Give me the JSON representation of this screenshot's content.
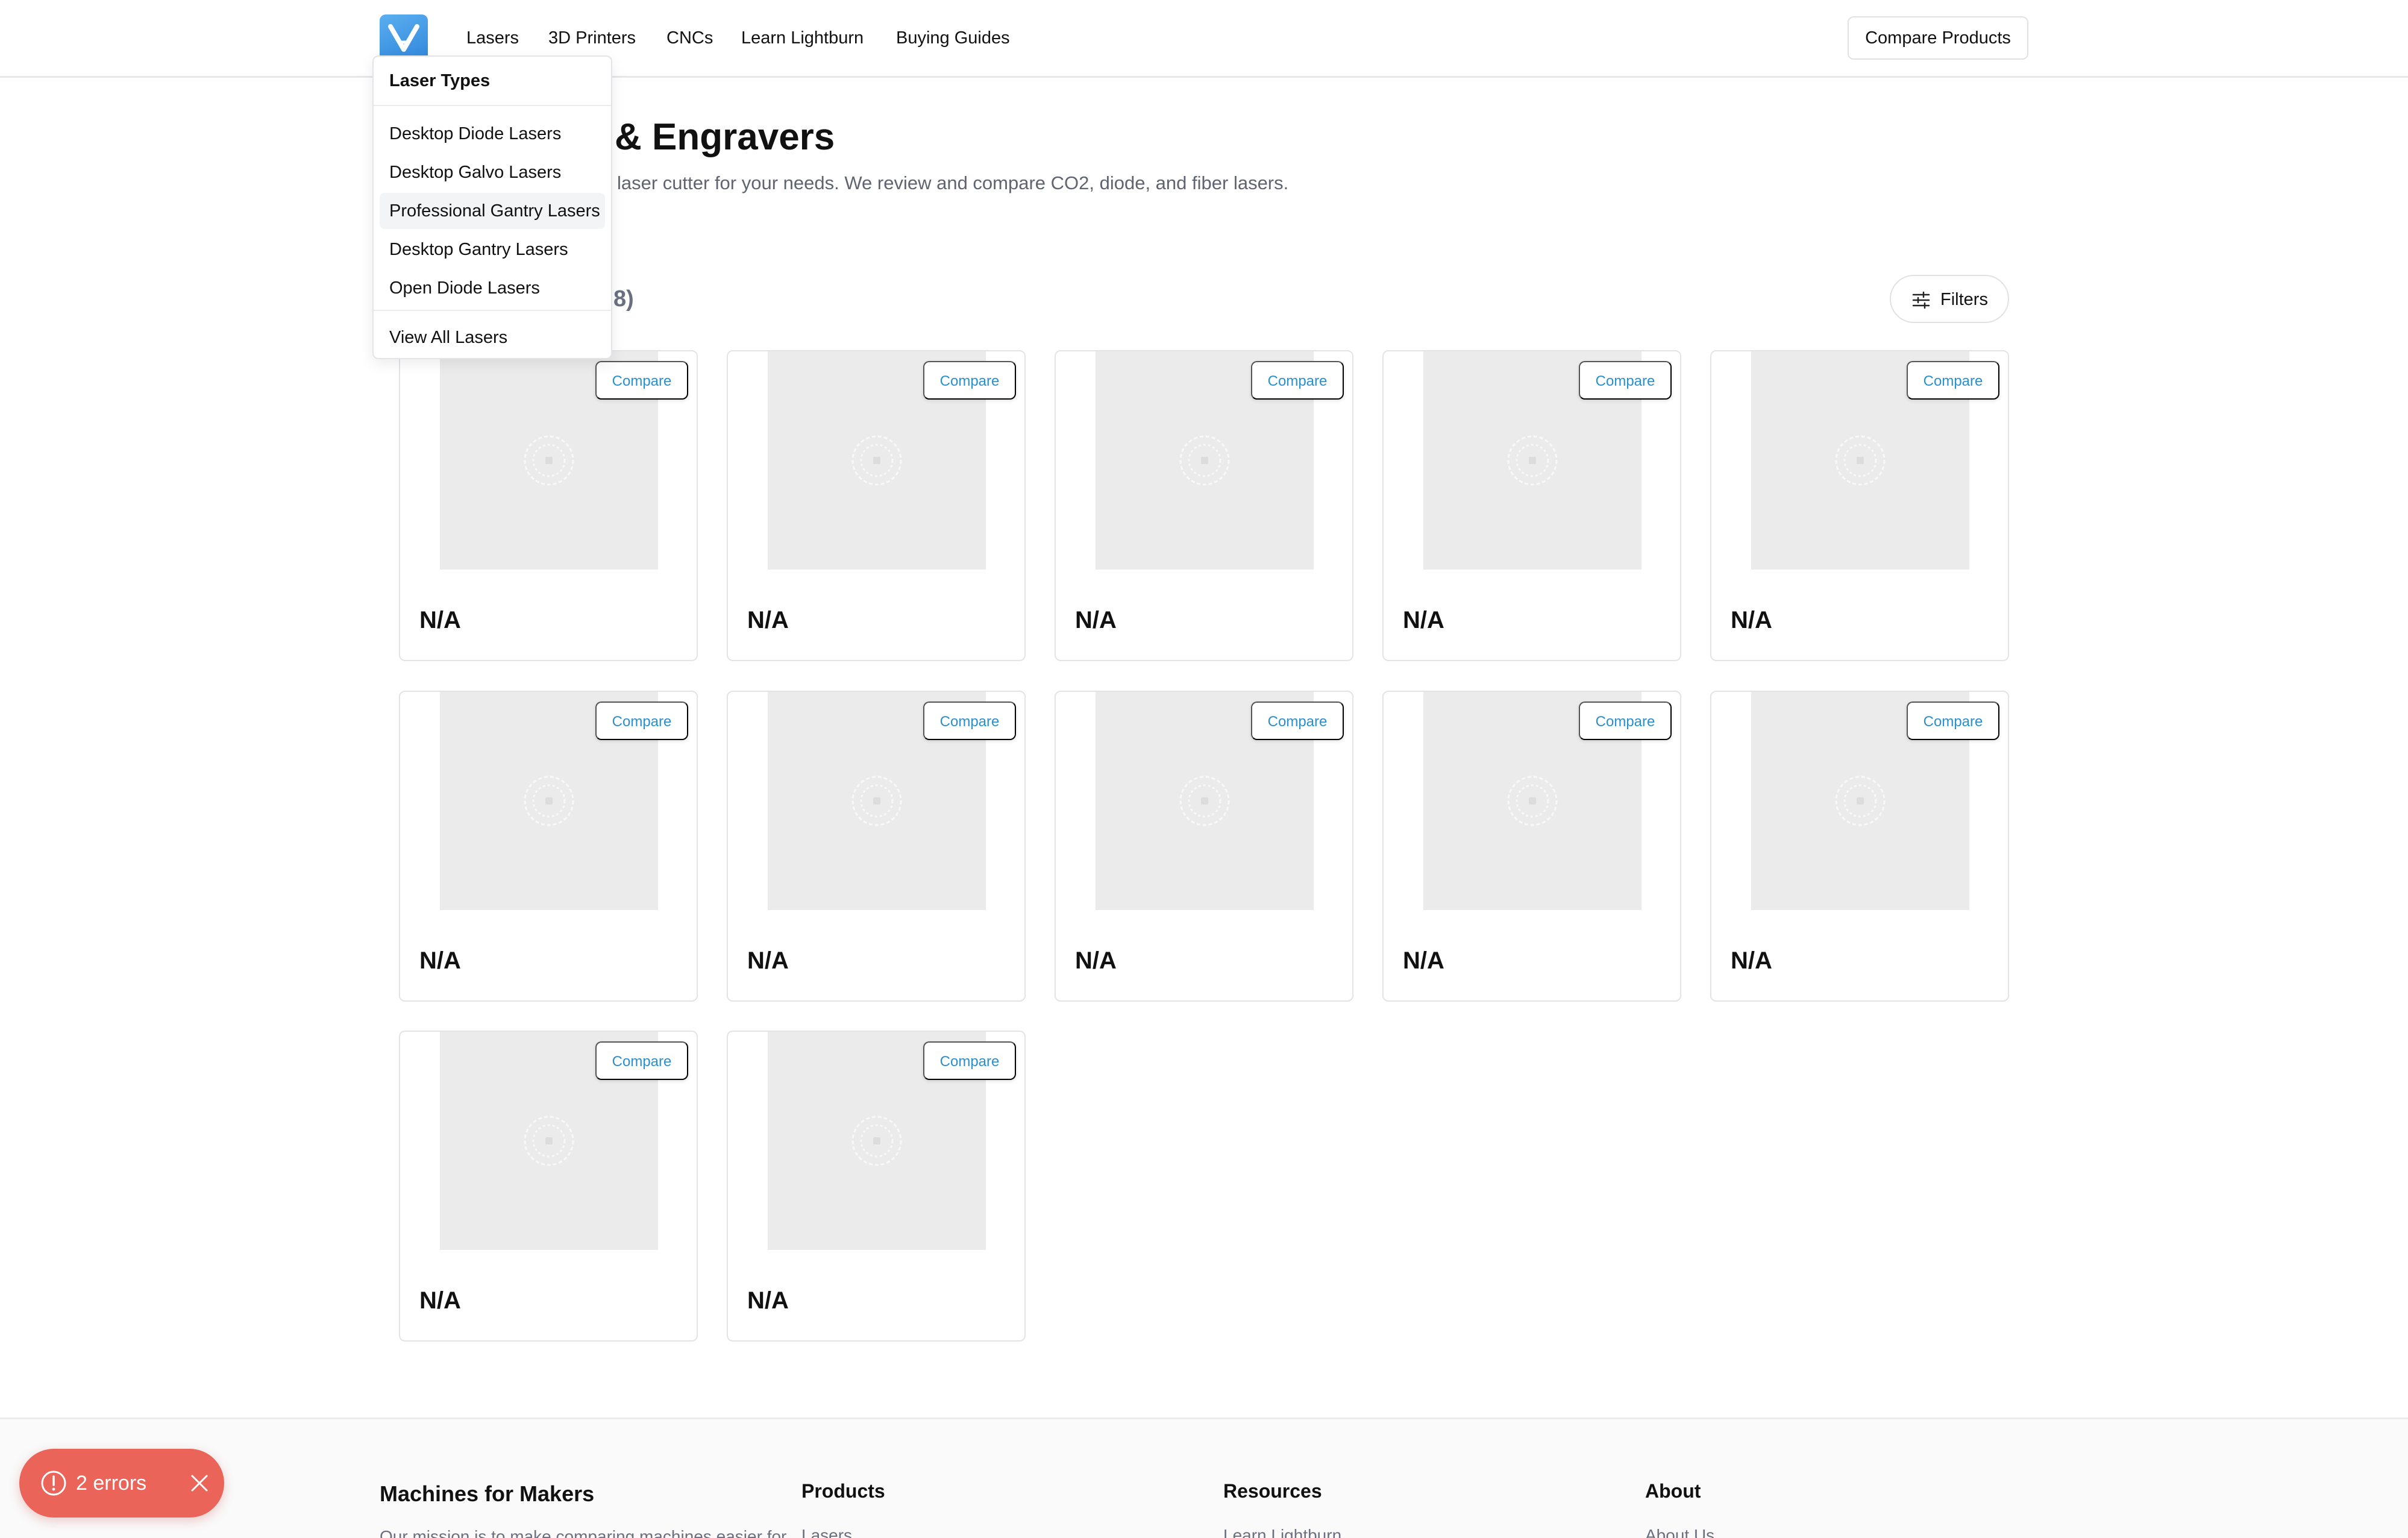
{
  "header": {
    "logo_alt": "Machines for Makers",
    "nav": [
      "Lasers",
      "3D Printers",
      "CNCs",
      "Learn Lightburn",
      "Buying Guides"
    ],
    "compare_button": "Compare Products"
  },
  "dropdown": {
    "heading": "Laser Types",
    "items": [
      {
        "label": "Desktop Diode Lasers",
        "highlighted": false
      },
      {
        "label": "Desktop Galvo Lasers",
        "highlighted": false
      },
      {
        "label": "Professional Gantry Lasers",
        "highlighted": true
      },
      {
        "label": "Desktop Gantry Lasers",
        "highlighted": false
      },
      {
        "label": "Open Diode Lasers",
        "highlighted": false
      }
    ],
    "view_all": "View All Lasers"
  },
  "main": {
    "title_visible": "& Engravers",
    "subtitle_visible": "laser cutter for your needs. We review and compare CO2, diode, and fiber lasers.",
    "count_visible": "8)",
    "filters_label": "Filters"
  },
  "products": [
    {
      "compare_label": "Compare",
      "price": "N/A"
    },
    {
      "compare_label": "Compare",
      "price": "N/A"
    },
    {
      "compare_label": "Compare",
      "price": "N/A"
    },
    {
      "compare_label": "Compare",
      "price": "N/A"
    },
    {
      "compare_label": "Compare",
      "price": "N/A"
    },
    {
      "compare_label": "Compare",
      "price": "N/A"
    },
    {
      "compare_label": "Compare",
      "price": "N/A"
    },
    {
      "compare_label": "Compare",
      "price": "N/A"
    },
    {
      "compare_label": "Compare",
      "price": "N/A"
    },
    {
      "compare_label": "Compare",
      "price": "N/A"
    },
    {
      "compare_label": "Compare",
      "price": "N/A"
    },
    {
      "compare_label": "Compare",
      "price": "N/A"
    }
  ],
  "footer": {
    "brand": "Machines for Makers",
    "brand_desc_partial": "Our mission is to make comparing machines easier for",
    "columns": [
      {
        "heading": "Products",
        "first_link_partial": "Lasers"
      },
      {
        "heading": "Resources",
        "first_link_partial": "Learn Lightburn"
      },
      {
        "heading": "About",
        "first_link_partial": "About Us"
      }
    ]
  },
  "toast": {
    "label": "2 errors"
  },
  "colors": {
    "accent": "#2b8fd0",
    "logo": "#3d95e0",
    "toast": "#ea6459",
    "placeholder": "#ebebeb"
  }
}
